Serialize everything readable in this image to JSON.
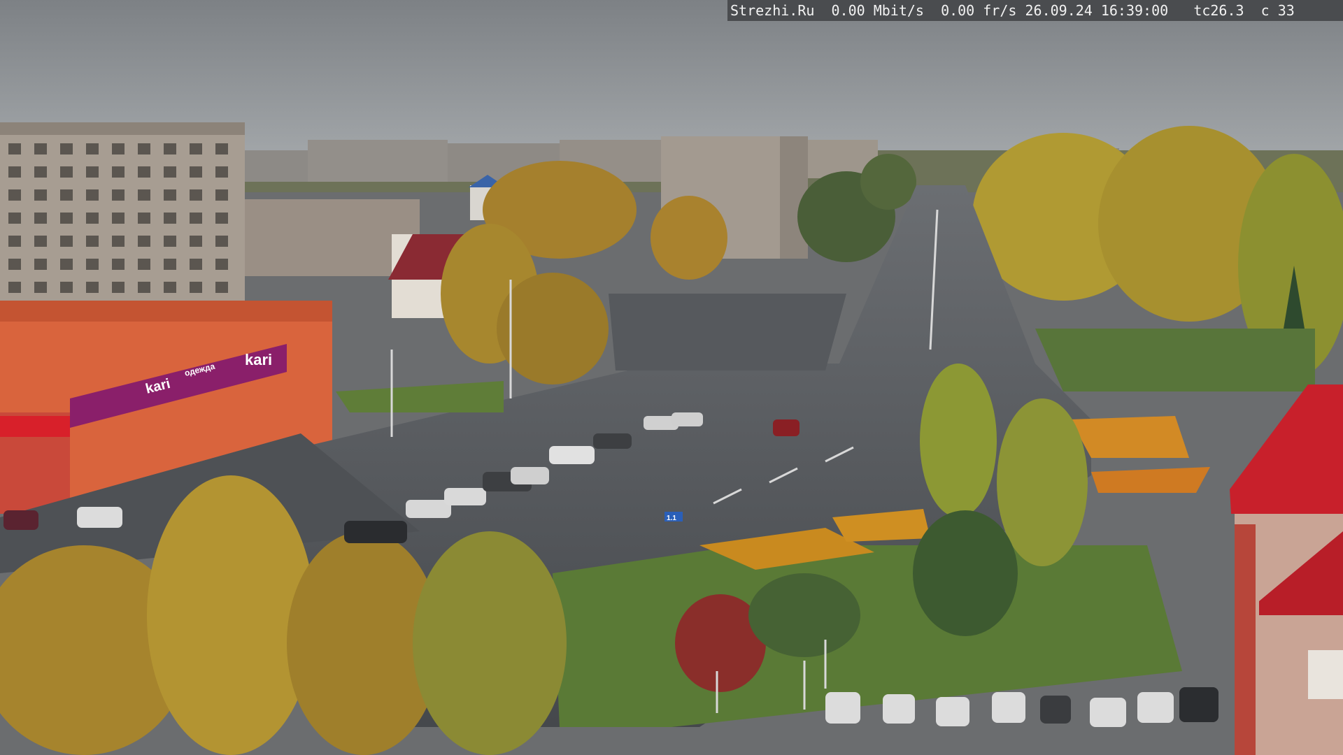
{
  "overlay": {
    "site": "Strezhi.Ru",
    "bitrate": "0.00 Mbit/s",
    "framerate": "0.00 fr/s",
    "datetime": "26.09.24 16:39:00",
    "temperature": "tc26.3",
    "channel": "c 33"
  },
  "signs": {
    "store_logo": "kari",
    "store_banner": "одежда",
    "store_logo_2": "kari",
    "road_sign": "1.1"
  },
  "colors": {
    "sky": "#8e9296",
    "asphalt": "#4c4f53",
    "store_banner": "#8a1f6a",
    "store_facade": "#d9643d",
    "grass": "#5a7a36",
    "foliage_yellow": "#b9962c",
    "tower_red": "#c8202b"
  }
}
